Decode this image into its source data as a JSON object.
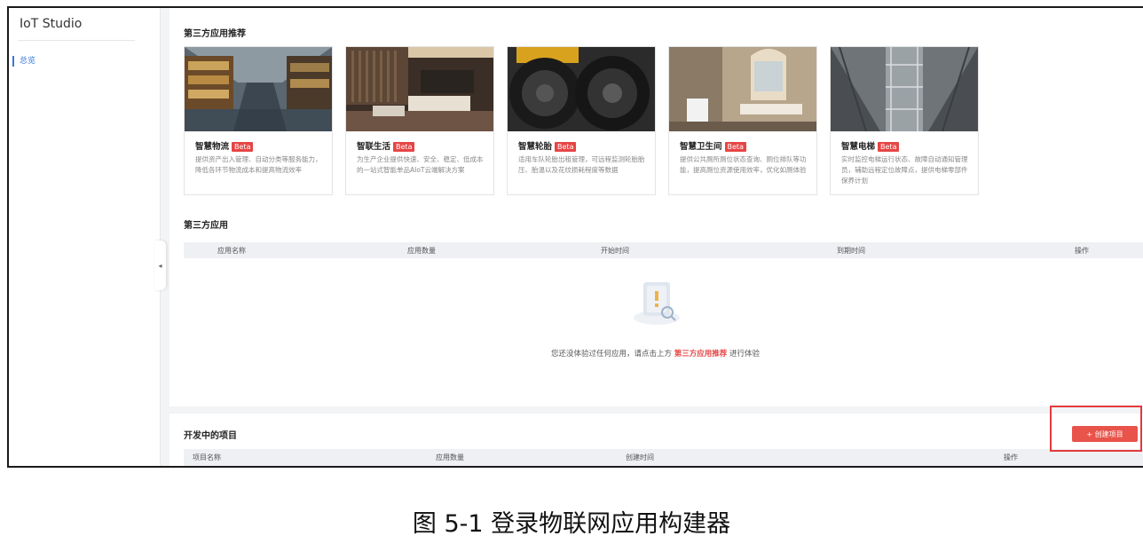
{
  "sidebar": {
    "brand": "IoT Studio",
    "nav_item": "总览",
    "collapse_icon": "◂"
  },
  "recommend": {
    "title": "第三方应用推荐",
    "apps": [
      {
        "name": "智慧物流",
        "badge": "Beta",
        "desc": "提供资产出入管理、自动分类等服务能力，降低各环节物流成本和提高物流效率"
      },
      {
        "name": "智联生活",
        "badge": "Beta",
        "desc": "为生产企业提供快速、安全、稳定、低成本的一站式智能单品AIoT云端解决方案"
      },
      {
        "name": "智慧轮胎",
        "badge": "Beta",
        "desc": "适用车队轮胎出租管理，可远程监测轮胎胎压、胎温以及花纹损耗程度等数据"
      },
      {
        "name": "智慧卫生间",
        "badge": "Beta",
        "desc": "提供公共厕所厕位状态查询、厕位排队等功能，提高厕位资源使用效率，优化如厕体验"
      },
      {
        "name": "智慧电梯",
        "badge": "Beta",
        "desc": "实时监控电梯运行状态、故障自动通知管理员，辅助远程定位故障点，提供电梯零部件保养计划"
      }
    ]
  },
  "third_party": {
    "title": "第三方应用",
    "columns": [
      "应用名称",
      "应用数量",
      "开始时间",
      "到期时间",
      "操作"
    ],
    "empty_prefix": "您还没体验过任何应用，请点击上方",
    "empty_link": "第三方应用推荐",
    "empty_suffix": "进行体验"
  },
  "projects": {
    "title": "开发中的项目",
    "create_button": "+ 创建项目",
    "columns": [
      "项目名称",
      "应用数量",
      "创建时间",
      "操作"
    ]
  },
  "caption": "图 5-1 登录物联网应用构建器"
}
